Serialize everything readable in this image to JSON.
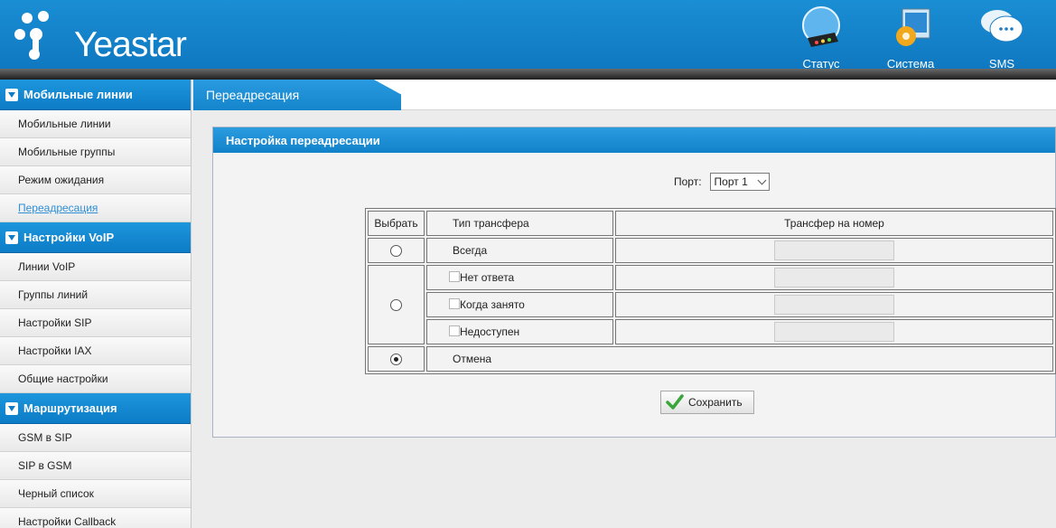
{
  "brand": {
    "logo_text": "Yeastar"
  },
  "topnav": [
    {
      "label": "Статус",
      "icon": "status-router-icon"
    },
    {
      "label": "Система",
      "icon": "system-gear-icon"
    },
    {
      "label": "SMS",
      "icon": "sms-chat-icon"
    }
  ],
  "sidebar": {
    "sections": [
      {
        "title": "Мобильные линии",
        "items": [
          "Мобильные линии",
          "Мобильные группы",
          "Режим ожидания",
          "Переадресация"
        ]
      },
      {
        "title": "Настройки VoIP",
        "items": [
          "Линии VoIP",
          "Группы линий",
          "Настройки SIP",
          "Настройки IAX",
          "Общие настройки"
        ]
      },
      {
        "title": "Маршрутизация",
        "items": [
          "GSM в SIP",
          "SIP в GSM",
          "Черный список",
          "Настройки Callback"
        ]
      }
    ],
    "active_item": "Переадресация"
  },
  "main": {
    "tab_title": "Переадресация",
    "panel_title": "Настройка переадресации",
    "port_label": "Порт:",
    "port_value": "Порт 1",
    "table": {
      "headers": [
        "Выбрать",
        "Тип трансфера",
        "Трансфер на номер"
      ],
      "rows": {
        "always": {
          "label": "Всегда",
          "selected": false,
          "number": ""
        },
        "no_answer": {
          "label": "Нет ответа",
          "checked": false,
          "number": ""
        },
        "busy": {
          "label": "Когда занято",
          "checked": false,
          "number": ""
        },
        "unavailable": {
          "label": "Недоступен",
          "checked": false,
          "number": ""
        },
        "conditional_selected": false,
        "cancel": {
          "label": "Отмена",
          "selected": true
        }
      }
    },
    "save_label": "Сохранить"
  },
  "colors": {
    "header_blue": "#1484cc",
    "link_active": "#2f8fd6",
    "save_check": "#3aa53a"
  }
}
